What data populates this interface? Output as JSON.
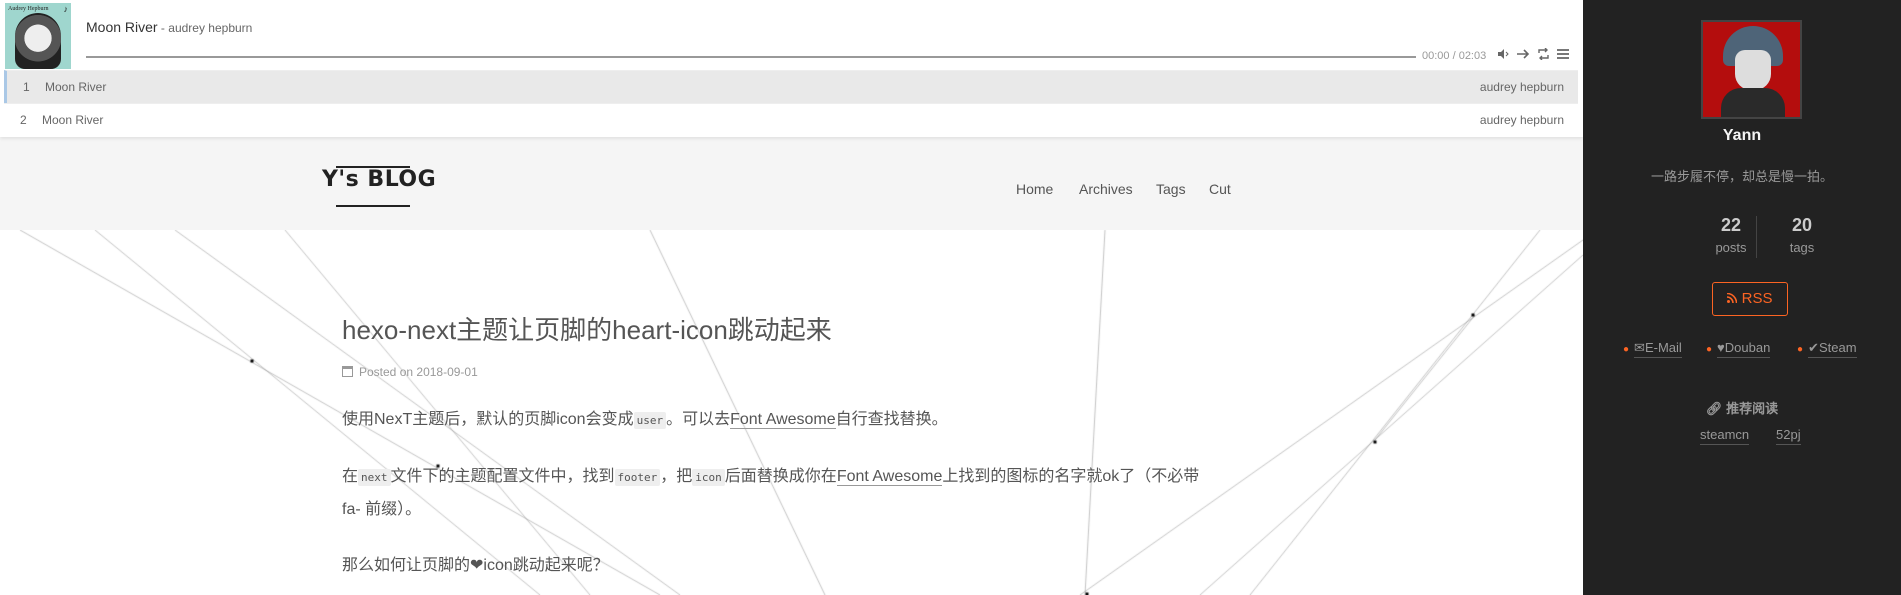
{
  "player": {
    "cover_text": "Audrey Hepburn",
    "song_title": "Moon River",
    "song_separator": " - ",
    "song_author": "audrey hepburn",
    "time": "00:00 / 02:03",
    "playlist": [
      {
        "index": "1",
        "name": "Moon River",
        "artist": "audrey hepburn"
      },
      {
        "index": "2",
        "name": "Moon River",
        "artist": "audrey hepburn"
      }
    ]
  },
  "header": {
    "logo": "Y's BLOG",
    "nav": [
      "Home",
      "Archives",
      "Tags",
      "Cut"
    ]
  },
  "post": {
    "title": "hexo-next主题让页脚的heart-icon跳动起来",
    "meta_label": "Posted on",
    "meta_date": "2018-09-01",
    "p1": {
      "a": "使用NexT主题后，默认的页脚icon会变成",
      "code": "user",
      "b": "。可以去",
      "link": "Font Awesome",
      "c": "自行查找替换。"
    },
    "p2": {
      "a": "在",
      "code1": "next",
      "b": "文件下的主题配置文件中，找到",
      "code2": "footer",
      "c": "，把",
      "code3": "icon",
      "d": "后面替换成你在",
      "link": "Font Awesome",
      "e": "上找到的图标的名字就ok了（不必带",
      "line2": "fa- 前缀）。"
    },
    "p3": {
      "a": "那么如何让页脚的",
      "heart": "❤",
      "b": "icon跳动起来呢？"
    }
  },
  "sidebar": {
    "name": "Yann",
    "motto": "一路步履不停，却总是慢一拍。",
    "posts_count": "22",
    "posts_label": "posts",
    "tags_count": "20",
    "tags_label": "tags",
    "rss_label": "RSS",
    "social": [
      "E-Mail",
      "Douban",
      "Steam"
    ],
    "recommend_title": "推荐阅读",
    "recommend_links": [
      "steamcn",
      "52pj"
    ]
  },
  "colors": {
    "accent": "#fc6423",
    "sidebar_bg": "#222222",
    "header_bg": "#f5f5f5"
  }
}
